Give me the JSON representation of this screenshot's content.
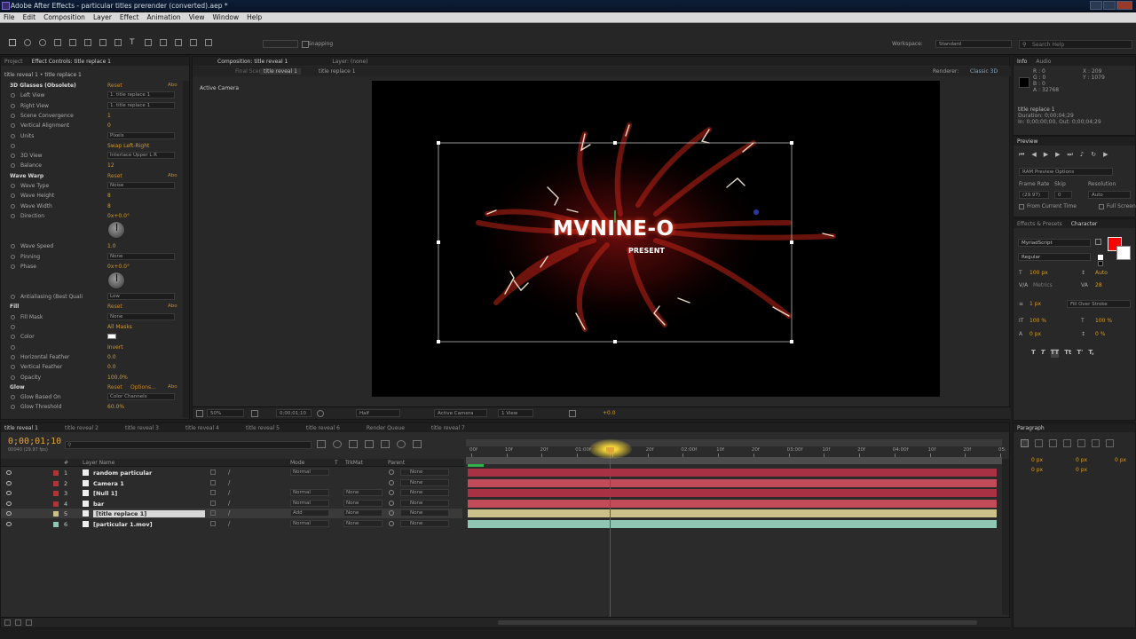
{
  "window": {
    "title": "Adobe After Effects - particular titles prerender (converted).aep *"
  },
  "menu": [
    "File",
    "Edit",
    "Composition",
    "Layer",
    "Effect",
    "Animation",
    "View",
    "Window",
    "Help"
  ],
  "toolbar": {
    "snapping_label": "Snapping",
    "workspace_label": "Workspace:",
    "workspace_value": "Standard",
    "search_placeholder": "Search Help"
  },
  "left_panel": {
    "tabs": [
      "Project",
      "Effect Controls: title replace 1"
    ],
    "breadcrumb": "title reveal 1 • title replace 1",
    "effects": [
      {
        "name": "3D Glasses (Obsolete)",
        "value": "Reset",
        "about": "Abo",
        "header": true
      },
      {
        "name": "Left View",
        "value": "1. title replace 1",
        "dropdown": true
      },
      {
        "name": "Right View",
        "value": "1. title replace 1",
        "dropdown": true
      },
      {
        "name": "Scene Convergence",
        "value": "1"
      },
      {
        "name": "Vertical Alignment",
        "value": "0"
      },
      {
        "name": "Units",
        "value": "Pixels",
        "dropdown": true
      },
      {
        "name": "",
        "value": "Swap Left-Right"
      },
      {
        "name": "3D View",
        "value": "Interlace Upper L R",
        "dropdown": true
      },
      {
        "name": "Balance",
        "value": "12"
      },
      {
        "name": "Wave Warp",
        "value": "Reset",
        "about": "Abo",
        "header": true
      },
      {
        "name": "Wave Type",
        "value": "Noise",
        "dropdown": true
      },
      {
        "name": "Wave Height",
        "value": "8"
      },
      {
        "name": "Wave Width",
        "value": "8"
      },
      {
        "name": "Direction",
        "value": "0x+0.0°"
      },
      {
        "name": "",
        "value": "",
        "knob": true
      },
      {
        "name": "Wave Speed",
        "value": "1.0"
      },
      {
        "name": "Pinning",
        "value": "None",
        "dropdown": true
      },
      {
        "name": "Phase",
        "value": "0x+0.0°"
      },
      {
        "name": "",
        "value": "",
        "knob": true
      },
      {
        "name": "Antialiasing (Best Quali",
        "value": "Low",
        "dropdown": true
      },
      {
        "name": "Fill",
        "value": "Reset",
        "about": "Abo",
        "header": true
      },
      {
        "name": "Fill Mask",
        "value": "None",
        "dropdown": true
      },
      {
        "name": "",
        "value": "All Masks"
      },
      {
        "name": "Color",
        "value": ""
      },
      {
        "name": "",
        "value": "Invert"
      },
      {
        "name": "Horizontal Feather",
        "value": "0.0"
      },
      {
        "name": "Vertical Feather",
        "value": "0.0"
      },
      {
        "name": "Opacity",
        "value": "100.0%"
      },
      {
        "name": "Glow",
        "value": "Reset",
        "options": "Options...",
        "about": "Abo",
        "header": true
      },
      {
        "name": "Glow Based On",
        "value": "Color Channels",
        "dropdown": true
      },
      {
        "name": "Glow Threshold",
        "value": "60.0%"
      }
    ]
  },
  "composition": {
    "tabs": [
      "Composition: title reveal 1",
      "Layer: (none)"
    ],
    "subtabs": [
      "Final Scene",
      "title reveal 1",
      "title replace 1"
    ],
    "renderer_label": "Renderer:",
    "renderer_value": "Classic 3D",
    "view_label": "Active Camera",
    "main_text": "MVNINE-O",
    "sub_text": "PRESENT",
    "footer": {
      "zoom": "50%",
      "time": "0;00;01;10",
      "resolution": "Half",
      "camera": "Active Camera",
      "views": "1 View",
      "exposure": "+0.0"
    }
  },
  "right_panel": {
    "info_tabs": [
      "Info",
      "Audio"
    ],
    "info": {
      "r": "R : 0",
      "g": "G : 0",
      "b": "B : 0",
      "a": "A : 32768",
      "x": "X : 209",
      "y": "Y : 1079"
    },
    "layer_info": [
      "title replace 1",
      "Duration: 0;00;04;29",
      "In: 0;00;00;00, Out: 0;00;04;29"
    ],
    "preview_tab": "Preview",
    "preview": {
      "options": "RAM Preview Options",
      "frame_rate_label": "Frame Rate",
      "skip_label": "Skip",
      "resolution_label": "Resolution",
      "frame_rate": "(29.97)",
      "skip": "0",
      "resolution": "Auto",
      "from_current": "From Current Time",
      "full_screen": "Full Screen"
    },
    "char_tabs": [
      "Effects & Presets",
      "Character"
    ],
    "character": {
      "font": "MyriadScript",
      "style": "Regular",
      "size": "100 px",
      "leading": "Auto",
      "tracking": "Metrics",
      "kerning": "28",
      "stroke_width": "1 px",
      "stroke_type": "Fill Over Stroke",
      "vscale": "100 %",
      "hscale": "100 %",
      "baseline": "0 px",
      "tsume": "0 %"
    },
    "paragraph_tab": "Paragraph",
    "paragraph": [
      "0 px",
      "0 px",
      "0 px",
      "0 px",
      "0 px"
    ],
    "colors": {
      "fill": "#ff0000",
      "stroke": "#ffffff"
    }
  },
  "timeline": {
    "tabs": [
      "title reveal 1",
      "title reveal 2",
      "title reveal 3",
      "title reveal 4",
      "title reveal 5",
      "title reveal 6",
      "Render Queue",
      "title reveal 7"
    ],
    "time": "0;00;01;10",
    "fps": "00040 (29.97 fps)",
    "columns": [
      "#",
      "Layer Name",
      "Mode",
      "T",
      "TrkMat",
      "Parent"
    ],
    "layers": [
      {
        "num": "1",
        "name": "random particular",
        "mode": "Normal",
        "trkmat": "",
        "parent": "None",
        "color": "#b23434"
      },
      {
        "num": "2",
        "name": "Camera 1",
        "mode": "",
        "trkmat": "",
        "parent": "None",
        "color": "#b23434"
      },
      {
        "num": "3",
        "name": "[Null 1]",
        "mode": "Normal",
        "trkmat": "None",
        "parent": "None",
        "color": "#b23434"
      },
      {
        "num": "4",
        "name": "bar",
        "mode": "Normal",
        "trkmat": "None",
        "parent": "None",
        "color": "#b23434"
      },
      {
        "num": "5",
        "name": "[title replace 1]",
        "mode": "Add",
        "trkmat": "None",
        "parent": "None",
        "color": "#cbbf8a"
      },
      {
        "num": "6",
        "name": "[particular 1.mov]",
        "mode": "Normal",
        "trkmat": "None",
        "parent": "None",
        "color": "#8fc7b4"
      }
    ],
    "ruler": [
      "00f",
      "10f",
      "20f",
      "01:00f",
      "10f",
      "20f",
      "02:00f",
      "10f",
      "20f",
      "03:00f",
      "10f",
      "20f",
      "04:00f",
      "10f",
      "20f",
      "05:"
    ]
  }
}
